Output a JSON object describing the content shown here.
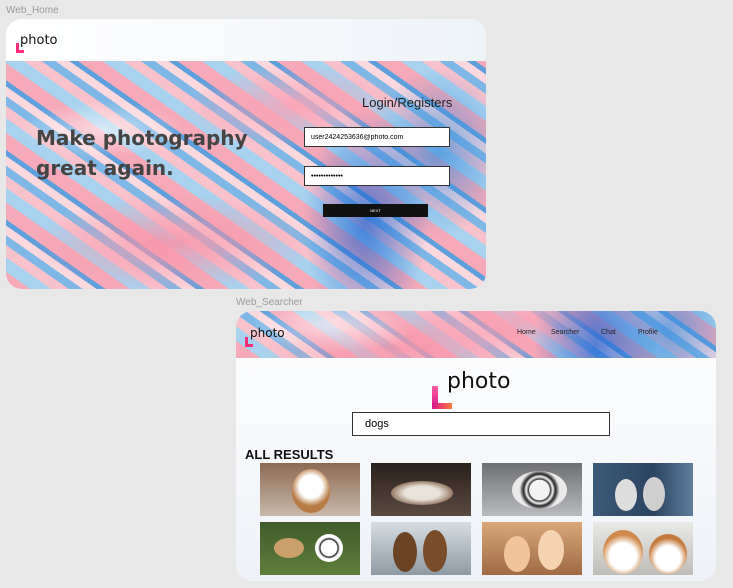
{
  "frames": {
    "home_label": "Web_Home",
    "searcher_label": "Web_Searcher"
  },
  "home": {
    "logo": "photo",
    "headline_line1": "Make photography",
    "headline_line2": "great again.",
    "login_title": "Login/Registers",
    "email_value": "user2424253636@photo.com",
    "password_value": "•••••••••••••",
    "next_label": "NEXT"
  },
  "searcher": {
    "logo": "photo",
    "nav": [
      "Home",
      "Searcher",
      "Chat",
      "Profile"
    ],
    "big_logo": "photo",
    "search_value": "dogs",
    "results_title": "ALL RESULTS",
    "results": [
      {
        "icon": "dog-photo",
        "alt": "jack russell terrier"
      },
      {
        "icon": "dog-photo",
        "alt": "husky lying on couch"
      },
      {
        "icon": "dog-photo",
        "alt": "dalmatian on sofa"
      },
      {
        "icon": "dog-photo",
        "alt": "two dogs by blue door"
      },
      {
        "icon": "dog-photo",
        "alt": "dogs playing on grass"
      },
      {
        "icon": "dog-photo",
        "alt": "two dogs in sweaters"
      },
      {
        "icon": "dog-photo",
        "alt": "puppies in jackets"
      },
      {
        "icon": "dog-photo",
        "alt": "two corgis"
      }
    ]
  },
  "colors": {
    "accent_pink": "#ff2d7a",
    "button_dark": "#111111",
    "headline": "#444444"
  }
}
